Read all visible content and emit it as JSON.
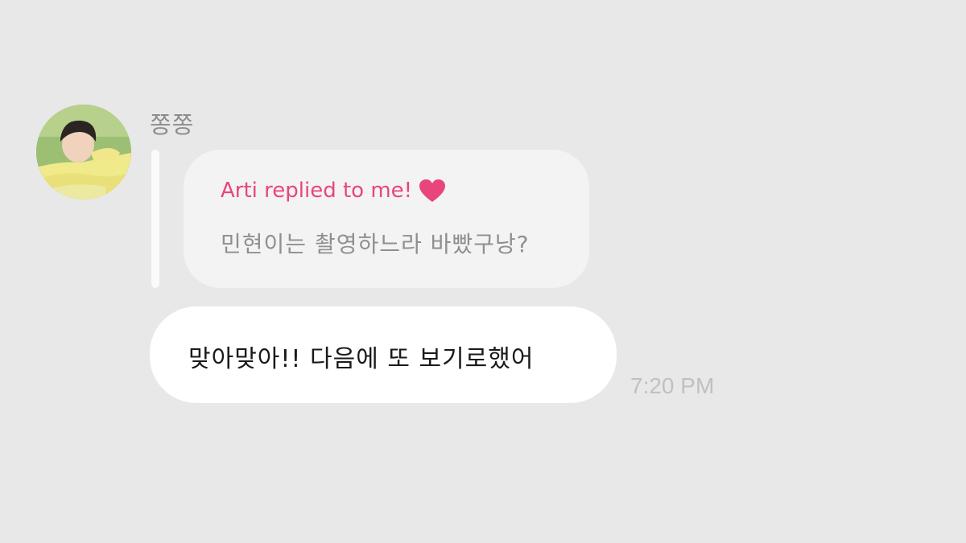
{
  "sender": {
    "name": "쫑쫑",
    "avatar": "profile-photo"
  },
  "reply": {
    "header": "Arti replied to me!",
    "icon": "heart-icon",
    "quoted_text": "민현이는 촬영하느라 바빴구낭?"
  },
  "message": {
    "text": "맞아맞아!! 다음에 또 보기로했어",
    "time": "7:20 PM"
  },
  "colors": {
    "background": "#e8e8e9",
    "reply_accent": "#e8467a",
    "heart": "#e8467a",
    "message_bubble": "#ffffff",
    "reply_bubble": "#f3f3f4"
  }
}
